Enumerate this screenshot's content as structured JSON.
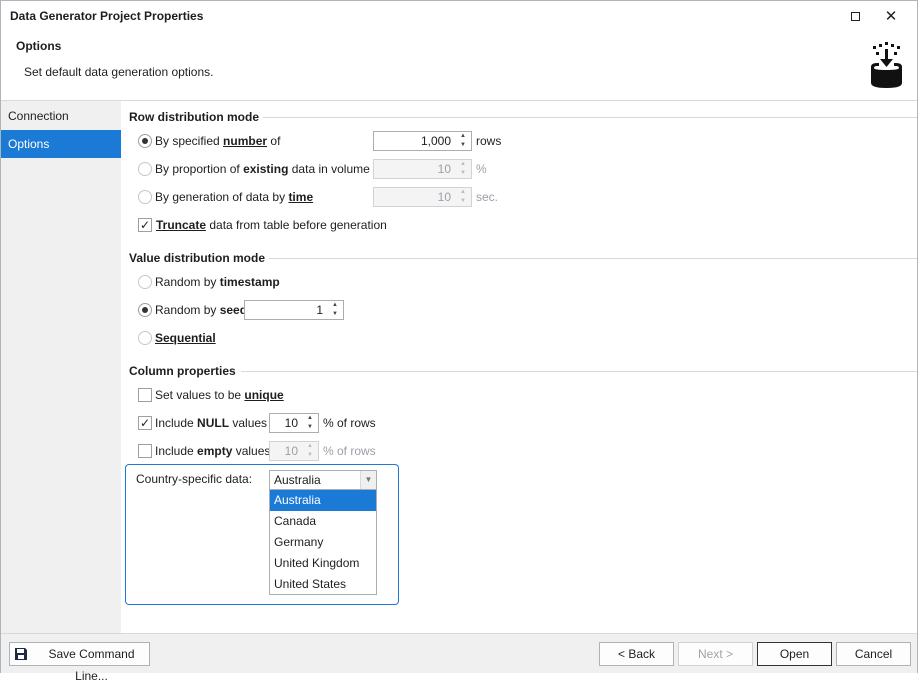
{
  "window": {
    "title": "Data Generator Project Properties",
    "maximize_glyph": "□",
    "close_glyph": "✕"
  },
  "header": {
    "title": "Options",
    "subtitle": "Set default data generation options.",
    "icon": "database-download-icon"
  },
  "sidebar": {
    "items": [
      {
        "label": "Connection",
        "active": false
      },
      {
        "label": "Options",
        "active": true
      }
    ]
  },
  "row_distribution": {
    "title": "Row distribution mode",
    "by_number": {
      "prefix": "By specified ",
      "key": "number",
      "suffix": " of",
      "value": "1,000",
      "unit": "rows",
      "selected": true
    },
    "by_proportion": {
      "prefix": "By proportion of ",
      "key": "existing",
      "middle": " data in volume of",
      "value": "10",
      "unit": "%",
      "selected": false
    },
    "by_time": {
      "prefix": "By generation of data by ",
      "key": "time",
      "value": "10",
      "unit": "sec.",
      "selected": false
    },
    "truncate": {
      "key": "Truncate",
      "suffix": " data from table before generation",
      "checked": true
    }
  },
  "value_distribution": {
    "title": "Value distribution mode",
    "timestamp": {
      "prefix": "Random by ",
      "key": "timestamp",
      "selected": false
    },
    "seed": {
      "prefix": "Random by ",
      "key": "seed",
      "value": "1",
      "selected": true
    },
    "sequential": {
      "key": "Sequential",
      "selected": false
    }
  },
  "column_properties": {
    "title": "Column properties",
    "unique": {
      "prefix": "Set values to be ",
      "key": "unique",
      "checked": false
    },
    "include_null": {
      "prefix": "Include ",
      "key": "NULL",
      "suffix": " values",
      "value": "10",
      "unit": "% of rows",
      "checked": true
    },
    "include_empty": {
      "prefix": "Include ",
      "key": "empty",
      "suffix": " values",
      "value": "10",
      "unit": "% of rows",
      "checked": false
    },
    "country": {
      "label": "Country-specific data:",
      "selected": "Australia",
      "options": [
        "Australia",
        "Canada",
        "Germany",
        "United Kingdom",
        "United States"
      ]
    }
  },
  "footer": {
    "save": "Save Command Line...",
    "back": "< Back",
    "next": "Next >",
    "open": "Open",
    "cancel": "Cancel"
  },
  "colors": {
    "accent": "#1b7ad6",
    "sidebar_bg": "#f0f0f0"
  }
}
